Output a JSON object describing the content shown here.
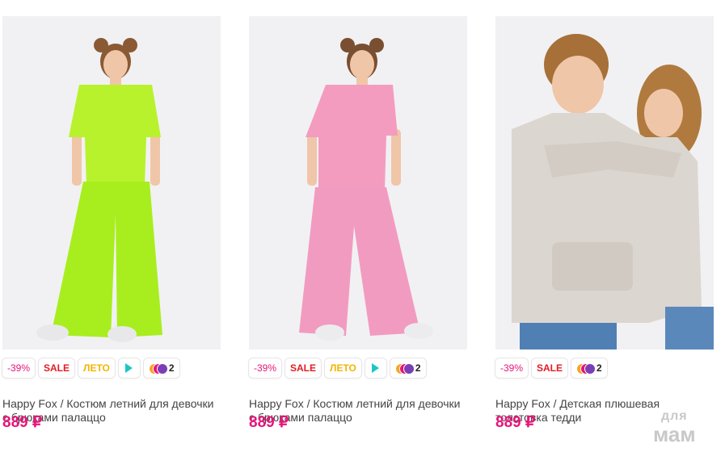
{
  "products": [
    {
      "badges": {
        "discount": "-39%",
        "sale": "SALE",
        "season": "ЛЕТО",
        "colors_count": "2"
      },
      "show_season": true,
      "show_play": true,
      "title_line1": "Happy Fox / Костюм летний для девочки",
      "title_line2": "с брюками палаццо",
      "price": "889 ₽",
      "image_colors": {
        "top": "#b8f22c",
        "pants": "#a8ee1e",
        "hair": "#8a5a34",
        "skin": "#f0c6a8"
      }
    },
    {
      "badges": {
        "discount": "-39%",
        "sale": "SALE",
        "season": "ЛЕТО",
        "colors_count": "2"
      },
      "show_season": true,
      "show_play": true,
      "title_line1": "Happy Fox / Костюм летний для девочки",
      "title_line2": "с брюками палаццо",
      "price": "889 ₽",
      "image_colors": {
        "top": "#f49cc0",
        "pants": "#f29bc1",
        "hair": "#7a4e30",
        "skin": "#f0c6a8"
      }
    },
    {
      "badges": {
        "discount": "-39%",
        "sale": "SALE",
        "colors_count": "2"
      },
      "show_season": false,
      "show_play": false,
      "title_line1": "Happy Fox / Детская плюшевая",
      "title_line2": "толстовка тедди",
      "price": "889 ₽",
      "image_colors": {
        "hoodie": "#dcd6d0",
        "jeans": "#4f7fb3",
        "hair": "#b07a3e",
        "skin": "#f0c6a8"
      }
    }
  ],
  "color_dots": [
    "#f5a623",
    "#e8157a",
    "#7b3fb5"
  ],
  "watermark": {
    "line1": "для",
    "line2": "мам"
  }
}
